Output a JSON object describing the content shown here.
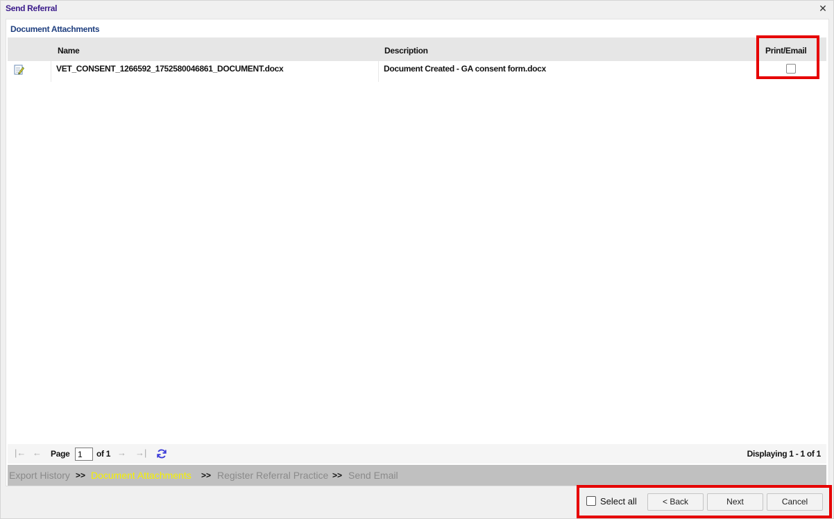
{
  "window": {
    "title": "Send Referral",
    "close_glyph": "✕"
  },
  "panel": {
    "header": "Document Attachments"
  },
  "table": {
    "columns": [
      "Name",
      "Description",
      "Print/Email"
    ],
    "rows": [
      {
        "icon": "edit-document-icon",
        "name": "VET_CONSENT_1266592_1752580046861_DOCUMENT.docx",
        "description": "Document Created - GA consent form.docx",
        "print_email_checked": false
      }
    ]
  },
  "pager": {
    "first_glyph": "|←",
    "prev_glyph": "←",
    "page_label": "Page",
    "page_value": "1",
    "of_label": "of 1",
    "next_glyph": "→",
    "last_glyph": "→|",
    "display_info": "Displaying 1 - 1 of 1"
  },
  "steps": {
    "items": [
      {
        "label": "Export History",
        "active": false
      },
      {
        "label": "Document Attachments",
        "active": true
      },
      {
        "label": "Register Referral Practice",
        "active": false
      },
      {
        "label": "Send Email",
        "active": false
      }
    ],
    "separator": ">>"
  },
  "footer": {
    "select_all_label": "Select all",
    "back_label": "< Back",
    "next_label": "Next",
    "cancel_label": "Cancel"
  },
  "colors": {
    "title": "#3a1a8a",
    "header": "#1f3f7f",
    "active_step": "#f5f000",
    "highlight": "#e60000"
  }
}
